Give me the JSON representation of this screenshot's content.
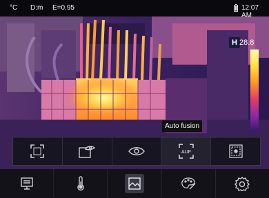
{
  "status": {
    "unit": "°C",
    "distance": "D:m",
    "emissivity": "E=0.95",
    "time": "12:07 AM"
  },
  "scale": {
    "mode_label": "H",
    "max_value": "28.8"
  },
  "tooltip": {
    "text": "Auto fusion"
  },
  "fusion_toolbar": {
    "items": [
      {
        "name": "full-screen",
        "icon": "fullscreen-icon"
      },
      {
        "name": "picture-in-picture",
        "icon": "pip-eye-icon"
      },
      {
        "name": "visible",
        "icon": "eye-icon"
      },
      {
        "name": "auto-fusion",
        "icon": "auf-icon",
        "label": "AUF"
      },
      {
        "name": "mix",
        "icon": "blend-icon"
      }
    ],
    "active": "auto-fusion"
  },
  "bottom_nav": {
    "items": [
      {
        "name": "settings-display",
        "icon": "monitor-icon"
      },
      {
        "name": "temperature",
        "icon": "thermometer-icon"
      },
      {
        "name": "image-mode",
        "icon": "image-icon"
      },
      {
        "name": "palette",
        "icon": "palette-icon"
      },
      {
        "name": "system",
        "icon": "gear-icon"
      }
    ],
    "active": "image-mode"
  },
  "colors": {
    "accent": "#ffffff",
    "hot": "#ffe040",
    "cold": "#3a1870"
  }
}
